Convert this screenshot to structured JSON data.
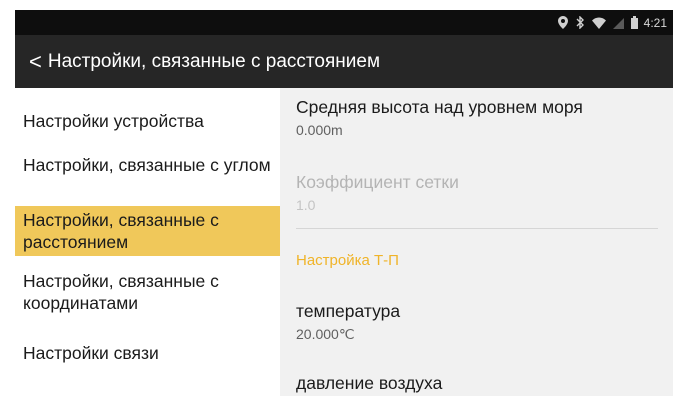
{
  "status": {
    "time": "4:21"
  },
  "header": {
    "back_glyph": "<",
    "title": "Настройки, связанные с расстоянием"
  },
  "sidebar": {
    "items": [
      {
        "label": "Настройки устройства"
      },
      {
        "label": "Настройки, связанные с углом"
      },
      {
        "label": "Настройки, связанные с расстоянием",
        "active": true
      },
      {
        "label": "Настройки, связанные с координатами"
      },
      {
        "label": "Настройки связи"
      }
    ]
  },
  "content": {
    "altitude": {
      "title": "Средняя высота над уровнем моря",
      "value": "0.000m"
    },
    "grid": {
      "title": "Коэффициент сетки",
      "value": "1.0"
    },
    "section_header": "Настройка Т-П",
    "temperature": {
      "title": "температура",
      "value": "20.000℃"
    },
    "pressure": {
      "title": "давление воздуха"
    }
  },
  "colors": {
    "accent": "#f0c85a",
    "header_text": "#f0b429",
    "title_bar": "#262626",
    "status_bar": "#0e0e0e"
  }
}
